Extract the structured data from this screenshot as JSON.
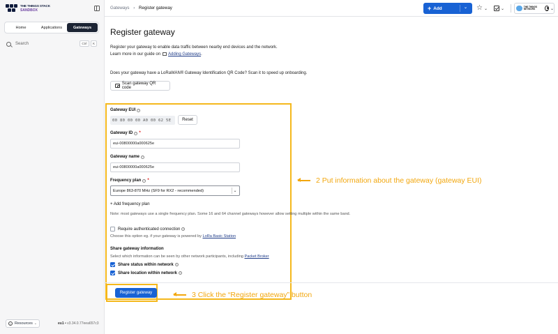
{
  "brand": {
    "line1": "THE THINGS STACK",
    "line2": "SANDBOX"
  },
  "sidebar": {
    "tabs": [
      {
        "label": "Home"
      },
      {
        "label": "Applications"
      },
      {
        "label": "Gateways"
      }
    ],
    "search": {
      "label": "Search",
      "kbd1": "Ctrl",
      "kbd2": "K"
    },
    "resources_label": "Resources",
    "cluster": "eu1",
    "version": "v3.34.0.77eea657c3"
  },
  "header": {
    "breadcrumb": [
      "Gateways",
      "Register gateway"
    ],
    "add_label": "Add",
    "profile_logo": "THE THINGS NETWORK"
  },
  "page": {
    "title": "Register gateway",
    "intro_line1": "Register your gateway to enable data traffic between nearby end devices and the network.",
    "intro_line2_prefix": "Learn more in our guide on",
    "intro_link": "Adding Gateways",
    "intro_line2_suffix": ".",
    "qr_question": "Does your gateway have a LoRaWAN® Gateway Identification QR Code? Scan it to speed up onboarding.",
    "scan_button": "Scan gateway QR code"
  },
  "form": {
    "eui_label": "Gateway EUI",
    "eui_value": "00 80 00 00 A0 00 62 5E",
    "reset_button": "Reset",
    "id_label": "Gateway ID",
    "id_value": "eui-00800000a000625e",
    "name_label": "Gateway name",
    "name_value": "eui-00800000a000625e",
    "fp_label": "Frequency plan",
    "fp_value": "Europe 863-870 MHz (SF9 for RX2 - recommended)",
    "add_fp": "+ Add frequency plan",
    "fp_note": "Note: most gateways use a single frequency plan. Some 16 and 64 channel gateways however allow setting multiple within the same band.",
    "auth_label": "Require authenticated connection",
    "auth_note_prefix": "Choose this option eg. if your gateway is powered by",
    "auth_note_link": "LoRa Basic Station",
    "share_heading": "Share gateway information",
    "share_note_prefix": "Select which information can be seen by other network participants, including",
    "share_note_link": "Packet Broker",
    "share_status": "Share status within network",
    "share_location": "Share location within network",
    "register_button": "Register gateway"
  },
  "annotations": {
    "a2": "2 Put information about the gateway (gateway EUI)",
    "a3": "3 Click the “Register gateway” button"
  },
  "colors": {
    "primary": "#1862d4",
    "highlight": "#f5b81c",
    "sidebar_dark": "#1c2434"
  }
}
